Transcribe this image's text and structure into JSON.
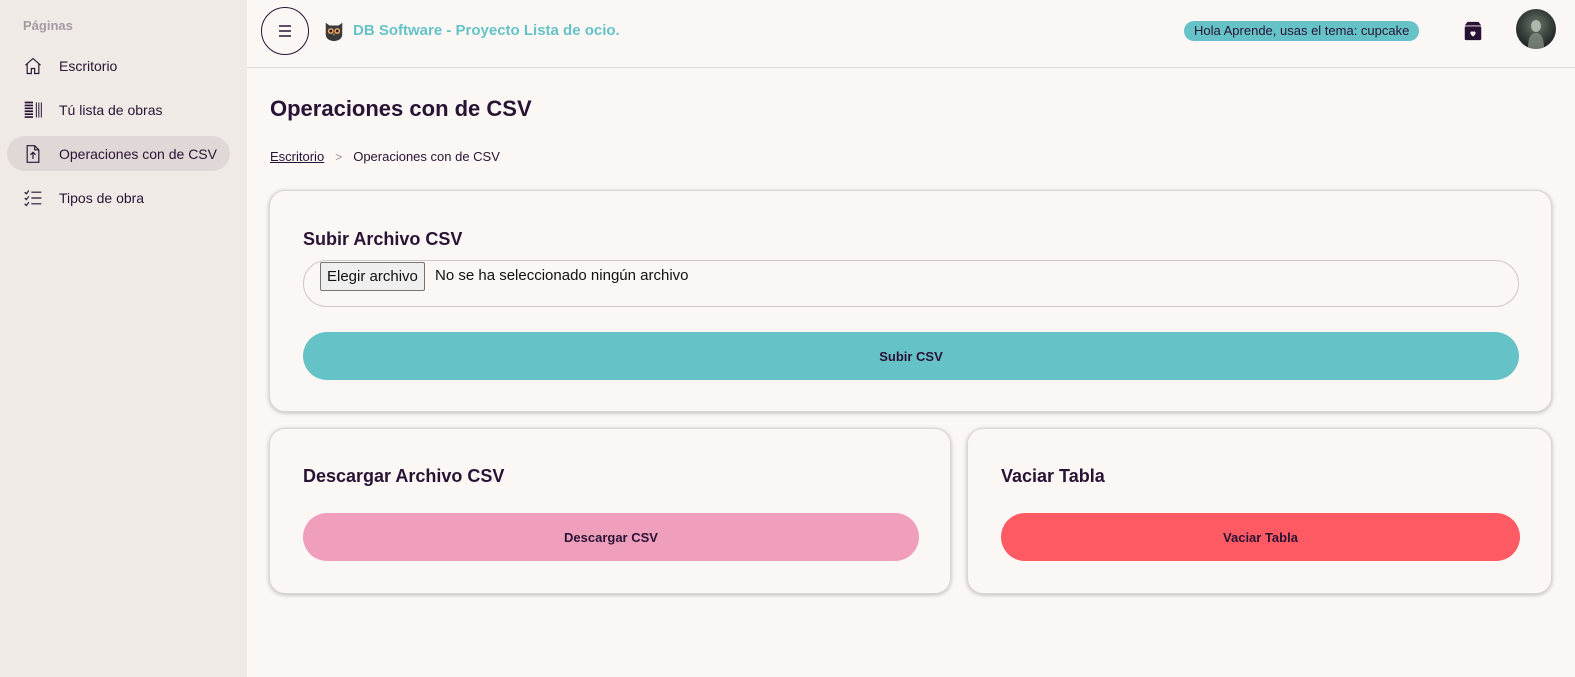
{
  "sidebar": {
    "heading": "Páginas",
    "items": [
      {
        "label": "Escritorio",
        "icon": "home-icon"
      },
      {
        "label": "Tú lista de obras",
        "icon": "list-icon"
      },
      {
        "label": "Operaciones con de CSV",
        "icon": "file-upload-icon",
        "active": true
      },
      {
        "label": "Tipos de obra",
        "icon": "checklist-icon"
      }
    ]
  },
  "header": {
    "menu_icon": "hamburger-icon",
    "logo_icon": "owl-logo-icon",
    "title": "DB Software - Proyecto Lista de ocio.",
    "theme_badge": "Hola Aprende, usas el tema: cupcake",
    "theme_icon": "theme-box-icon",
    "avatar": "user-avatar"
  },
  "main": {
    "page_title": "Operaciones con de CSV",
    "breadcrumb": {
      "home": "Escritorio",
      "separator": ">",
      "current": "Operaciones con de CSV"
    },
    "upload_card": {
      "title": "Subir Archivo CSV",
      "file_button": "Elegir archivo",
      "file_status": "No se ha seleccionado ningún archivo",
      "submit_label": "Subir CSV"
    },
    "download_card": {
      "title": "Descargar Archivo CSV",
      "button_label": "Descargar CSV"
    },
    "clear_card": {
      "title": "Vaciar Tabla",
      "button_label": "Vaciar Tabla"
    }
  },
  "colors": {
    "primary": "#65c3c8",
    "secondary": "#ef9fbc",
    "error": "#fe5a63",
    "text": "#291334",
    "background": "#faf7f5",
    "sidebar": "#efeae6"
  }
}
